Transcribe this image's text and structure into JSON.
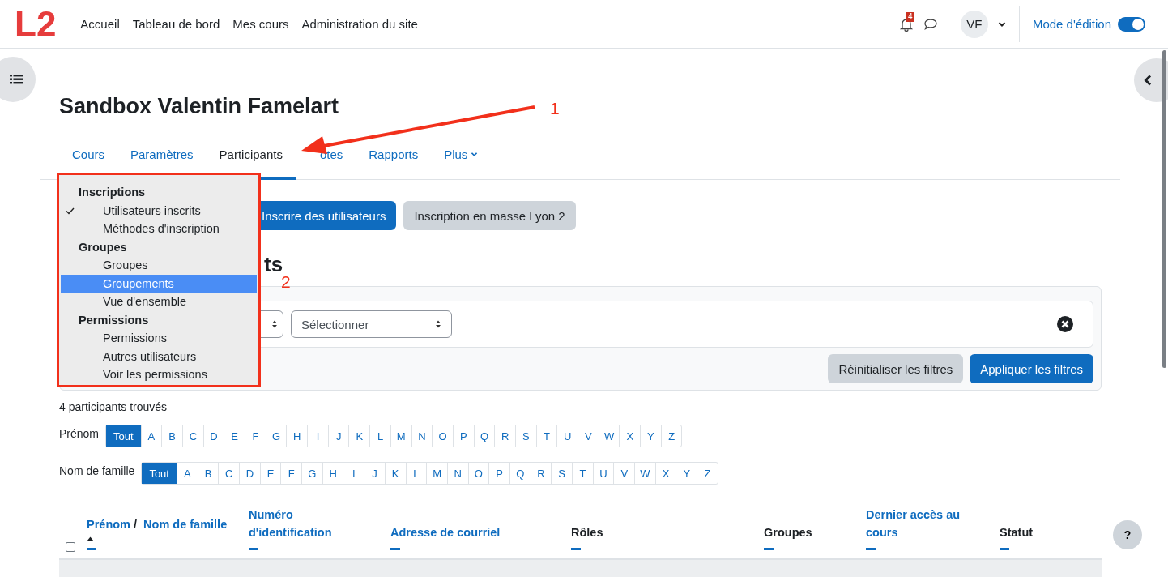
{
  "navbar": {
    "logo": "L2",
    "links": [
      "Accueil",
      "Tableau de bord",
      "Mes cours",
      "Administration du site"
    ],
    "notifications": {
      "count": "4"
    },
    "avatar": "VF",
    "edit_mode": {
      "label": "Mode d'édition",
      "on": true
    }
  },
  "course": {
    "title": "Sandbox Valentin Famelart"
  },
  "tabs": [
    {
      "label": "Cours",
      "selected": false,
      "caret": false
    },
    {
      "label": "Paramètres",
      "selected": false,
      "caret": false
    },
    {
      "label": "Participants",
      "selected": true,
      "caret": false
    },
    {
      "label": "otes",
      "selected": false,
      "caret": false
    },
    {
      "label": "Rapports",
      "selected": false,
      "caret": false
    },
    {
      "label": "Plus",
      "selected": false,
      "caret": true
    }
  ],
  "dropdown": [
    {
      "heading": "Inscriptions",
      "items": [
        {
          "label": "Utilisateurs inscrits",
          "checked": true,
          "selected": false
        },
        {
          "label": "Méthodes d'inscription",
          "checked": false,
          "selected": false
        }
      ]
    },
    {
      "heading": "Groupes",
      "items": [
        {
          "label": "Groupes",
          "checked": false,
          "selected": false
        },
        {
          "label": "Groupements",
          "checked": false,
          "selected": true
        },
        {
          "label": "Vue d'ensemble",
          "checked": false,
          "selected": false
        }
      ]
    },
    {
      "heading": "Permissions",
      "items": [
        {
          "label": "Permissions",
          "checked": false,
          "selected": false
        },
        {
          "label": "Autres utilisateurs",
          "checked": false,
          "selected": false
        },
        {
          "label": "Voir les permissions",
          "checked": false,
          "selected": false
        }
      ]
    }
  ],
  "actions": [
    {
      "label": "Inscrire des utilisateurs",
      "kind": "primary"
    },
    {
      "label": "Inscription en masse Lyon 2",
      "kind": "secondary"
    }
  ],
  "heading_visible": "ts",
  "filters": {
    "select": "Sélectionner",
    "buttons": [
      {
        "label": "Réinitialiser les filtres",
        "kind": "secondary"
      },
      {
        "label": "Appliquer les filtres",
        "kind": "primary"
      }
    ]
  },
  "count": "4 participants trouvés",
  "initials": [
    {
      "label": "Prénom",
      "letters": [
        {
          "label": "Tout",
          "selected": true
        },
        {
          "label": "A",
          "selected": false
        },
        {
          "label": "B",
          "selected": false
        },
        {
          "label": "C",
          "selected": false
        },
        {
          "label": "D",
          "selected": false
        },
        {
          "label": "E",
          "selected": false
        },
        {
          "label": "F",
          "selected": false
        },
        {
          "label": "G",
          "selected": false
        },
        {
          "label": "H",
          "selected": false
        },
        {
          "label": "I",
          "selected": false
        },
        {
          "label": "J",
          "selected": false
        },
        {
          "label": "K",
          "selected": false
        },
        {
          "label": "L",
          "selected": false
        },
        {
          "label": "M",
          "selected": false
        },
        {
          "label": "N",
          "selected": false
        },
        {
          "label": "O",
          "selected": false
        },
        {
          "label": "P",
          "selected": false
        },
        {
          "label": "Q",
          "selected": false
        },
        {
          "label": "R",
          "selected": false
        },
        {
          "label": "S",
          "selected": false
        },
        {
          "label": "T",
          "selected": false
        },
        {
          "label": "U",
          "selected": false
        },
        {
          "label": "V",
          "selected": false
        },
        {
          "label": "W",
          "selected": false
        },
        {
          "label": "X",
          "selected": false
        },
        {
          "label": "Y",
          "selected": false
        },
        {
          "label": "Z",
          "selected": false
        }
      ]
    },
    {
      "label": "Nom de famille",
      "letters": [
        {
          "label": "Tout",
          "selected": true
        },
        {
          "label": "A",
          "selected": false
        },
        {
          "label": "B",
          "selected": false
        },
        {
          "label": "C",
          "selected": false
        },
        {
          "label": "D",
          "selected": false
        },
        {
          "label": "E",
          "selected": false
        },
        {
          "label": "F",
          "selected": false
        },
        {
          "label": "G",
          "selected": false
        },
        {
          "label": "H",
          "selected": false
        },
        {
          "label": "I",
          "selected": false
        },
        {
          "label": "J",
          "selected": false
        },
        {
          "label": "K",
          "selected": false
        },
        {
          "label": "L",
          "selected": false
        },
        {
          "label": "M",
          "selected": false
        },
        {
          "label": "N",
          "selected": false
        },
        {
          "label": "O",
          "selected": false
        },
        {
          "label": "P",
          "selected": false
        },
        {
          "label": "Q",
          "selected": false
        },
        {
          "label": "R",
          "selected": false
        },
        {
          "label": "S",
          "selected": false
        },
        {
          "label": "T",
          "selected": false
        },
        {
          "label": "U",
          "selected": false
        },
        {
          "label": "V",
          "selected": false
        },
        {
          "label": "W",
          "selected": false
        },
        {
          "label": "X",
          "selected": false
        },
        {
          "label": "Y",
          "selected": false
        },
        {
          "label": "Z",
          "selected": false
        }
      ]
    }
  ],
  "table": {
    "select_all": {
      "checked": false
    },
    "columns": [
      {
        "parts": [
          "Prénom",
          "Nom de famille"
        ],
        "separator": "/",
        "sortable": true,
        "sorted": true
      },
      {
        "parts": [
          "Numéro d'identification"
        ],
        "sortable": true,
        "sorted": false
      },
      {
        "parts": [
          "Adresse de courriel"
        ],
        "sortable": true,
        "sorted": false
      },
      {
        "parts": [
          "Rôles"
        ],
        "sortable": false
      },
      {
        "parts": [
          "Groupes"
        ],
        "sortable": false
      },
      {
        "parts": [
          "Dernier accès au cours"
        ],
        "sortable": true,
        "sorted": false
      },
      {
        "parts": [
          "Statut"
        ],
        "sortable": false
      }
    ]
  },
  "help": "?",
  "annotations": [
    "1",
    "2"
  ]
}
